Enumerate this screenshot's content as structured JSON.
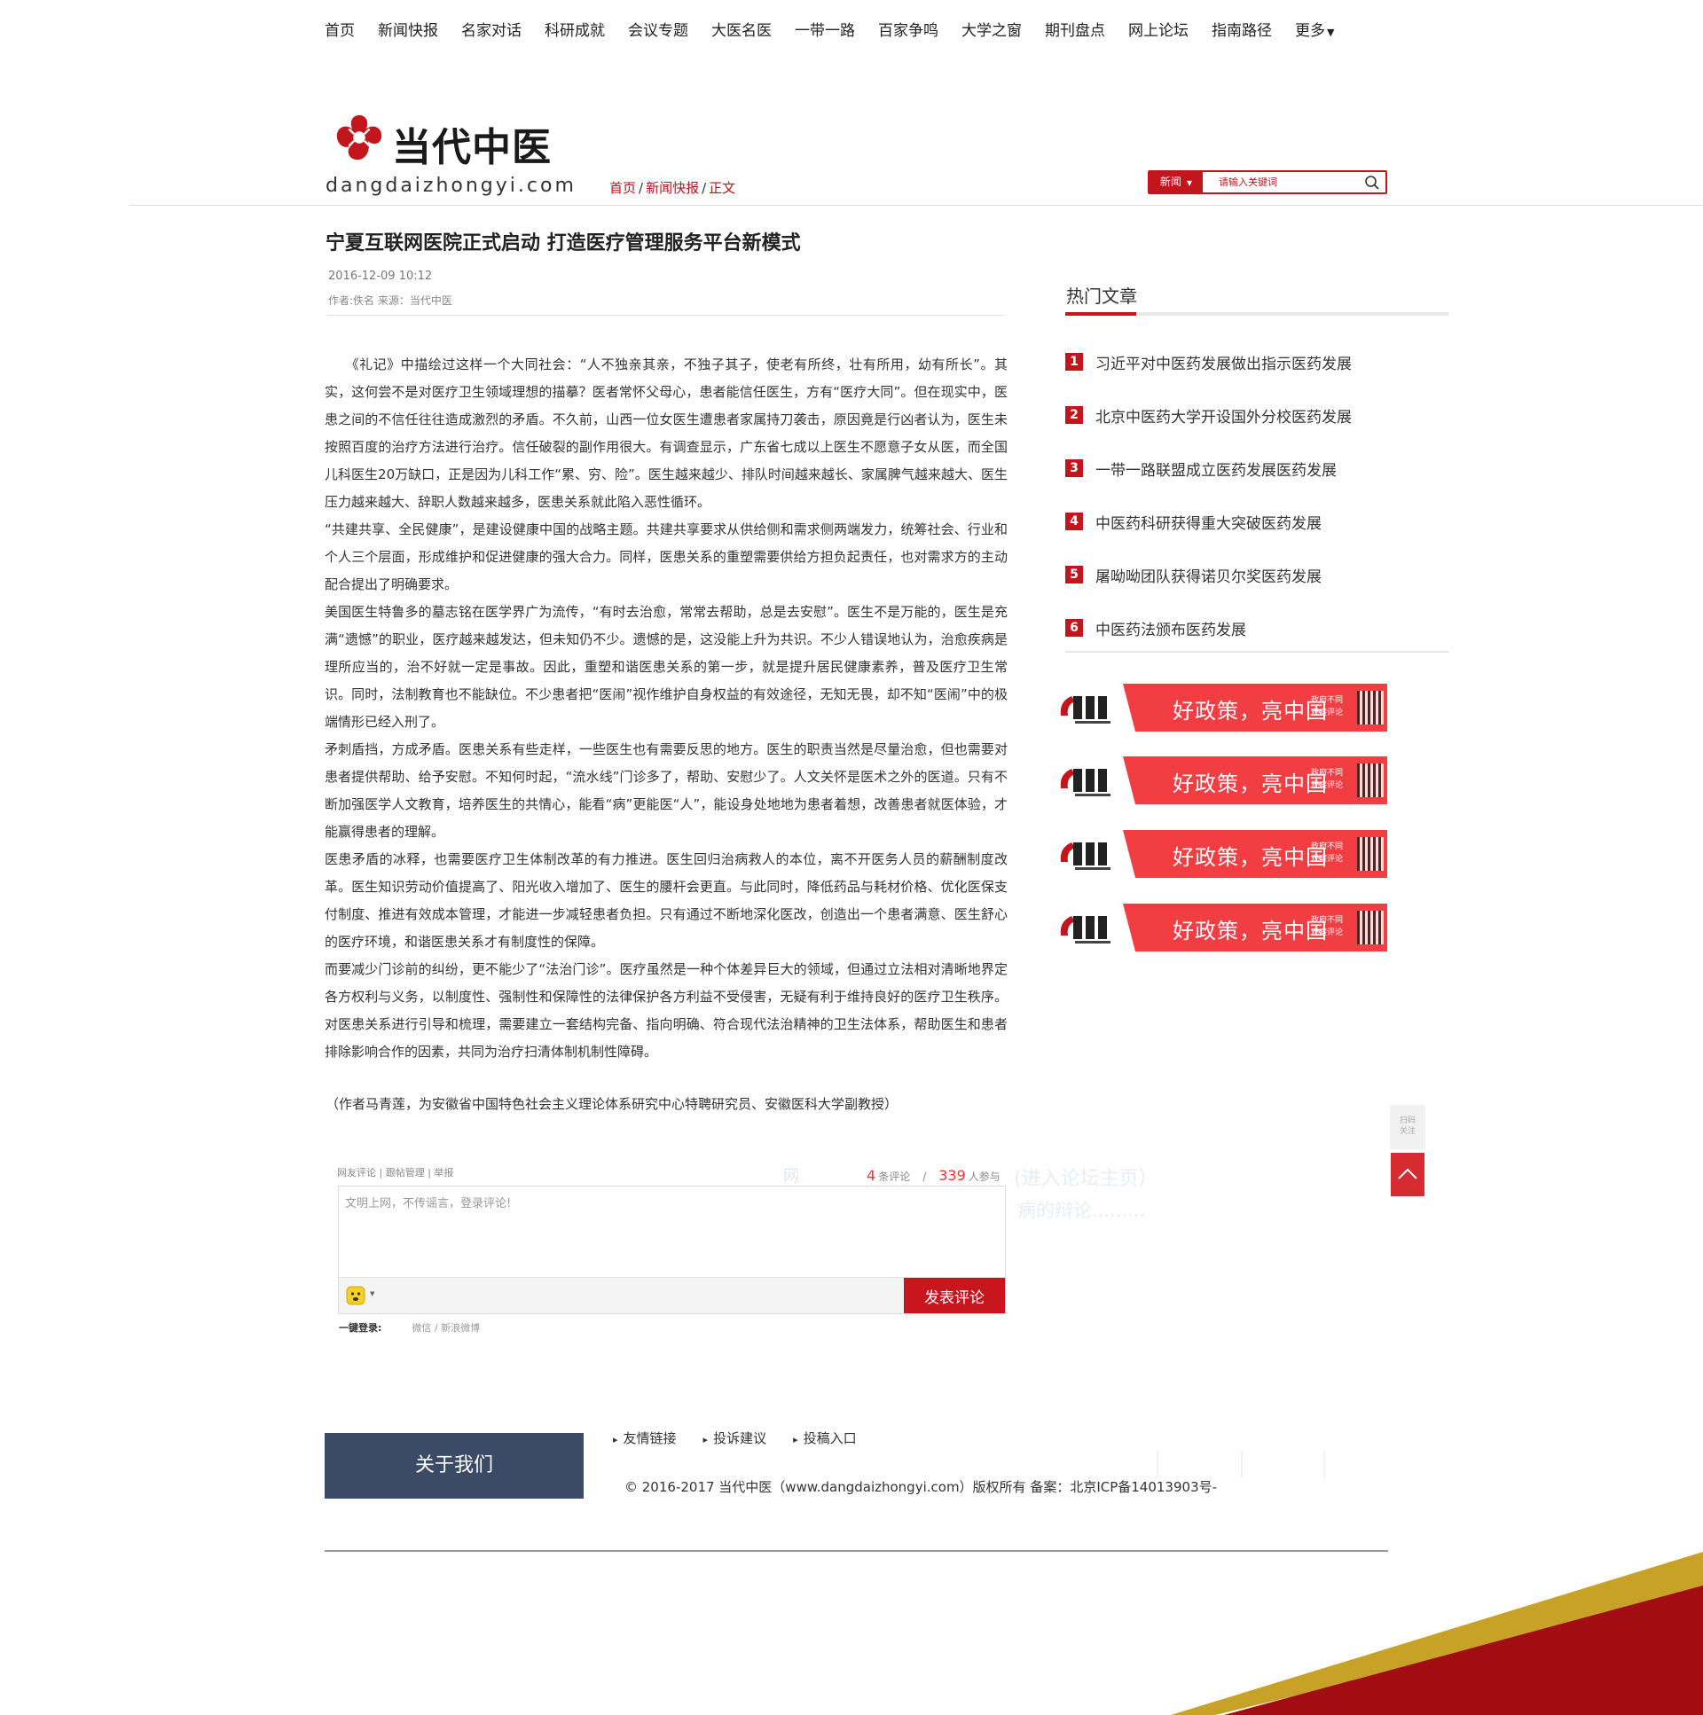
{
  "nav": {
    "items": [
      "首页",
      "新闻快报",
      "名家对话",
      "科研成就",
      "会议专题",
      "大医名医",
      "一带一路",
      "百家争鸣",
      "大学之窗",
      "期刊盘点",
      "网上论坛",
      "指南路径"
    ],
    "more": "更多"
  },
  "site": {
    "name": "当代中医",
    "domain": "dangdaizhongyi.com"
  },
  "breadcrumb": {
    "home": "首页",
    "section": "新闻快报",
    "current": "正文",
    "sep": "/"
  },
  "search": {
    "category": "新闻",
    "placeholder": "请输入关键词",
    "value": ""
  },
  "article": {
    "title": "宁夏互联网医院正式启动 打造医疗管理服务平台新模式",
    "date": "2016-12-09 10:12",
    "meta": "作者:佚名  来源：当代中医",
    "paragraphs": [
      "　　《礼记》中描绘过这样一个大同社会：“人不独亲其亲，不独子其子，使老有所终，壮有所用，幼有所长”。其实，这何尝不是对医疗卫生领域理想的描摹？医者常怀父母心，患者能信任医生，方有“医疗大同”。但在现实中，医患之间的不信任往往造成激烈的矛盾。不久前，山西一位女医生遭患者家属持刀袭击，原因竟是行凶者认为，医生未按照百度的治疗方法进行治疗。信任破裂的副作用很大。有调查显示，广东省七成以上医生不愿意子女从医，而全国儿科医生20万缺口，正是因为儿科工作“累、穷、险”。医生越来越少、排队时间越来越长、家属脾气越来越大、医生压力越来越大、辞职人数越来越多，医患关系就此陷入恶性循环。",
      "“共建共享、全民健康”，是建设健康中国的战略主题。共建共享要求从供给侧和需求侧两端发力，统筹社会、行业和个人三个层面，形成维护和促进健康的强大合力。同样，医患关系的重塑需要供给方担负起责任，也对需求方的主动配合提出了明确要求。",
      "美国医生特鲁多的墓志铭在医学界广为流传，“有时去治愈，常常去帮助，总是去安慰”。医生不是万能的，医生是充满“遗憾”的职业，医疗越来越发达，但未知仍不少。遗憾的是，这没能上升为共识。不少人错误地认为，治愈疾病是理所应当的，治不好就一定是事故。因此，重塑和谐医患关系的第一步，就是提升居民健康素养，普及医疗卫生常识。同时，法制教育也不能缺位。不少患者把“医闹”视作维护自身权益的有效途径，无知无畏，却不知“医闹”中的极端情形已经入刑了。",
      "矛刺盾挡，方成矛盾。医患关系有些走样，一些医生也有需要反思的地方。医生的职责当然是尽量治愈，但也需要对患者提供帮助、给予安慰。不知何时起，“流水线”门诊多了，帮助、安慰少了。人文关怀是医术之外的医道。只有不断加强医学人文教育，培养医生的共情心，能看“病”更能医“人”，能设身处地地为患者着想，改善患者就医体验，才能赢得患者的理解。",
      "医患矛盾的冰释，也需要医疗卫生体制改革的有力推进。医生回归治病救人的本位，离不开医务人员的薪酬制度改革。医生知识劳动价值提高了、阳光收入增加了、医生的腰杆会更直。与此同时，降低药品与耗材价格、优化医保支付制度、推进有效成本管理，才能进一步减轻患者负担。只有通过不断地深化医改，创造出一个患者满意、医生舒心的医疗环境，和谐医患关系才有制度性的保障。",
      "而要减少门诊前的纠纷，更不能少了“法治门诊”。医疗虽然是一种个体差异巨大的领域，但通过立法相对清晰地界定各方权利与义务，以制度性、强制性和保障性的法律保护各方利益不受侵害，无疑有利于维持良好的医疗卫生秩序。对医患关系进行引导和梳理，需要建立一套结构完备、指向明确、符合现代法治精神的卫生法体系，帮助医生和患者排除影响合作的因素，共同为治疗扫清体制机制性障碍。"
    ],
    "author_note": "（作者马青莲，为安徽省中国特色社会主义理论体系研究中心特聘研究员、安徽医科大学副教授）"
  },
  "comments": {
    "links": "网友评论 | 跟帖管理 | 举报",
    "net_label": "网",
    "count": "4",
    "count_label": "条评论",
    "participants": "339",
    "participants_label": "人参与",
    "faded_line1": "(进入论坛主页）",
    "faded_line2": "病的辩论.........",
    "placeholder": "文明上网，不传谣言，登录评论!",
    "submit_label": "发表评论",
    "login_label": "一键登录:",
    "login_options": "微信 / 新浪微博"
  },
  "sidebar": {
    "hot_title": "热门文章",
    "hot_articles": [
      {
        "rank": "1",
        "title": "习近平对中医药发展做出指示医药发展"
      },
      {
        "rank": "2",
        "title": "北京中医药大学开设国外分校医药发展"
      },
      {
        "rank": "3",
        "title": "一带一路联盟成立医药发展医药发展"
      },
      {
        "rank": "4",
        "title": "中医药科研获得重大突破医药发展"
      },
      {
        "rank": "5",
        "title": "屠呦呦团队获得诺贝尔奖医药发展"
      },
      {
        "rank": "6",
        "title": "中医药法颁布医药发展"
      }
    ],
    "ads": [
      {
        "slogan": "好政策，亮中国",
        "sub": "政府不同 观察评论"
      },
      {
        "slogan": "好政策，亮中国",
        "sub": "政府不同 观察评论"
      },
      {
        "slogan": "好政策，亮中国",
        "sub": "政府不同 观察评论"
      },
      {
        "slogan": "好政策，亮中国",
        "sub": "政府不同 观察评论"
      }
    ]
  },
  "float": {
    "qr_label": "扫码关注"
  },
  "footer": {
    "about": "关于我们",
    "links": [
      "友情链接",
      "投诉建议",
      "投稿入口"
    ],
    "copyright": "© 2016-2017 当代中医（www.dangdaizhongyi.com）版权所有 备案：北京ICP备14013903号-"
  },
  "colors": {
    "brand_red": "#c3161c",
    "footer_blue": "#3b4a66",
    "gold": "#c8a227",
    "dark_red": "#a20d14"
  }
}
